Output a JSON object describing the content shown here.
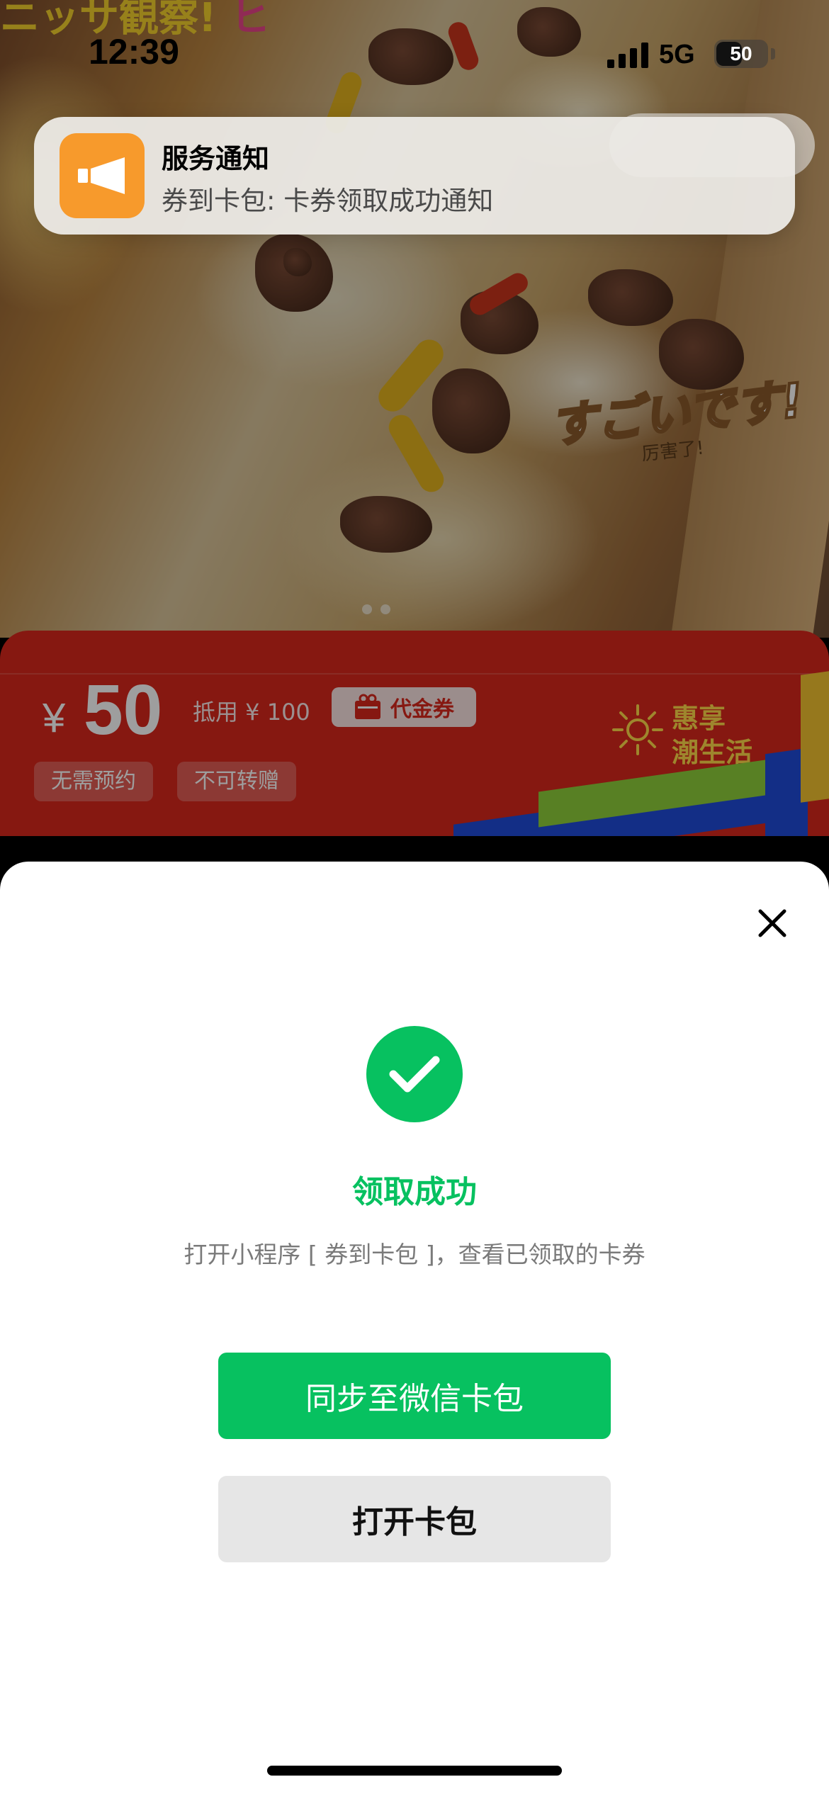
{
  "status_bar": {
    "time": "12:39",
    "network": "5G",
    "battery": "50"
  },
  "notification": {
    "app_icon": "megaphone-icon",
    "title": "服务通知",
    "body": "券到卡包: 卡券领取成功通知",
    "icon_color": "#f79a2c"
  },
  "background_image": {
    "overlay_text_main": "すごいです!",
    "overlay_text_sub": "厉害了!"
  },
  "coupon": {
    "currency": "¥",
    "amount": "50",
    "deduct_text": "抵用 ¥ 100",
    "type_label": "代金券",
    "tags": [
      "无需预约",
      "不可转赠"
    ],
    "brand_lines": [
      "惠享",
      "潮生活"
    ],
    "card_color": "#d8271c"
  },
  "sheet": {
    "success_title": "领取成功",
    "success_desc": "打开小程序 [ 券到卡包 ]，查看已领取的卡券",
    "primary_button": "同步至微信卡包",
    "secondary_button": "打开卡包",
    "accent_color": "#07c160"
  }
}
